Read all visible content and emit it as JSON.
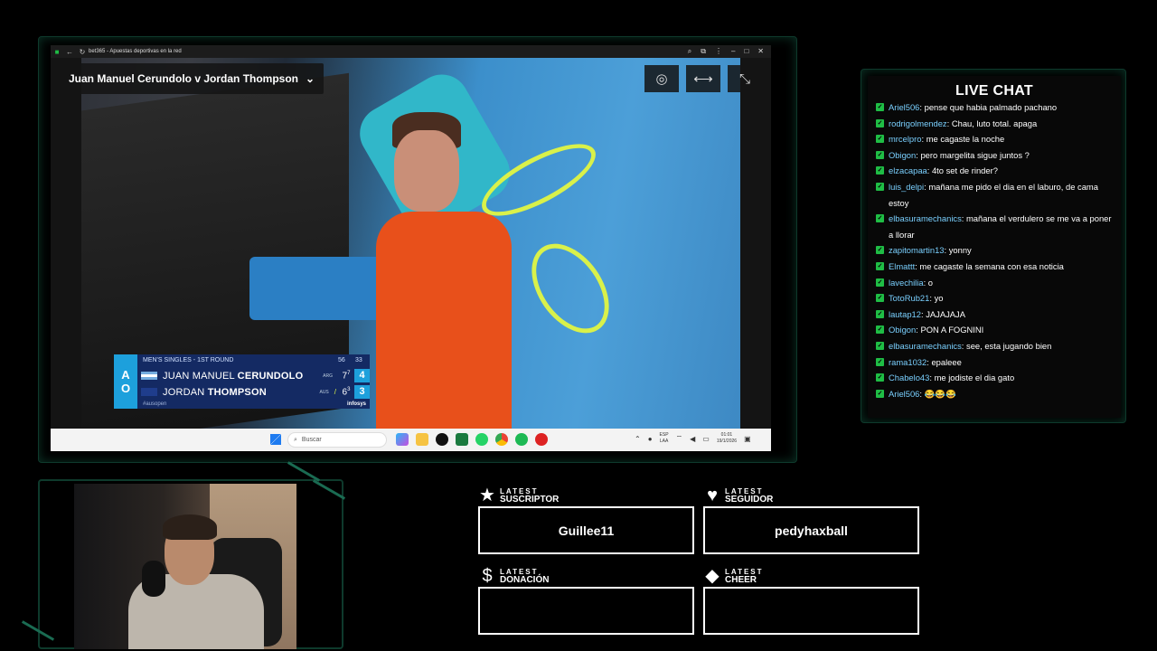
{
  "browser": {
    "tab_title": "bet365 - Apuestas deportivas en la red",
    "match_title": "Juan Manuel Cerundolo v Jordan Thompson"
  },
  "scoreboard": {
    "round": "MEN'S SINGLES - 1ST ROUND",
    "headers": [
      "56",
      "33"
    ],
    "players": [
      {
        "name_first": "JUAN MANUEL ",
        "name_last": "CERUNDOLO",
        "country": "ARG",
        "set": "7",
        "set_sup": "7",
        "points": "4",
        "flag_color": "#74acdf"
      },
      {
        "name_first": "JORDAN ",
        "name_last": "THOMPSON",
        "country": "AUS",
        "set": "6",
        "set_sup": "3",
        "points": "3",
        "flag_color": "#1f3d8c"
      }
    ],
    "hashtag": "#ausopen",
    "sponsor": "infosys",
    "logo": [
      "A",
      "O"
    ]
  },
  "taskbar": {
    "search_placeholder": "Buscar",
    "lang_top": "ESP",
    "lang_bottom": "LAA",
    "time": "01:01",
    "date": "19/1/2026"
  },
  "chat": {
    "title": "LIVE CHAT",
    "messages": [
      {
        "user": "Ariel506",
        "text": "pense que habia palmado pachano"
      },
      {
        "user": "rodrigolmendez",
        "text": "Chau, luto total. apaga"
      },
      {
        "user": "mrcelpro",
        "text": "me cagaste la noche"
      },
      {
        "user": "Obigon",
        "text": "pero margelita sigue juntos ?"
      },
      {
        "user": "elzacapaa",
        "text": "4to set de rinder?"
      },
      {
        "user": "luis_delpi",
        "text": "mañana me pido el dia en el laburo, de cama estoy"
      },
      {
        "user": "elbasuramechanics",
        "text": "mañana el verdulero se me va a poner a llorar"
      },
      {
        "user": "zapitomartin13",
        "text": "yonny"
      },
      {
        "user": "Elmattt",
        "text": "me cagaste la semana con esa noticia"
      },
      {
        "user": "lavechilia",
        "text": "o"
      },
      {
        "user": "TotoRub21",
        "text": "yo"
      },
      {
        "user": "lautap12",
        "text": "JAJAJAJA"
      },
      {
        "user": "Obigon",
        "text": "PON A FOGNINI"
      },
      {
        "user": "elbasuramechanics",
        "text": "see, esta jugando bien"
      },
      {
        "user": "rama1032",
        "text": "epaleee"
      },
      {
        "user": "Chabelo43",
        "text": "me jodiste el dia gato"
      },
      {
        "user": "Ariel506",
        "text": "😂😂😂"
      }
    ]
  },
  "latest": [
    {
      "label_small": "LATEST",
      "label_big": "SUSCRIPTOR",
      "icon": "star-icon",
      "glyph": "★",
      "value": "Guillee11"
    },
    {
      "label_small": "LATEST",
      "label_big": "SEGUIDOR",
      "icon": "heart-icon",
      "glyph": "♥",
      "value": "pedyhaxball"
    },
    {
      "label_small": "LATEST",
      "label_big": "DONACIÓN",
      "icon": "dollar-icon",
      "glyph": "$",
      "value": ""
    },
    {
      "label_small": "LATEST",
      "label_big": "CHEER",
      "icon": "diamond-icon",
      "glyph": "◆",
      "value": ""
    }
  ],
  "colors": {
    "accent": "#1fbd45",
    "frame": "#0e3a2c",
    "username": "#7ad0ff",
    "scoreboard": "#142a63"
  }
}
